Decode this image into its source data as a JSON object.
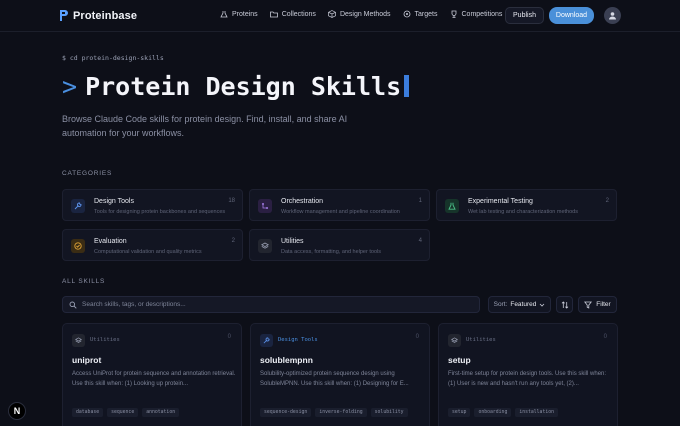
{
  "header": {
    "logo_text": "Proteinbase",
    "nav": [
      {
        "label": "Proteins",
        "icon": "flask-icon"
      },
      {
        "label": "Collections",
        "icon": "folder-icon"
      },
      {
        "label": "Design Methods",
        "icon": "cube-icon"
      },
      {
        "label": "Targets",
        "icon": "target-icon"
      },
      {
        "label": "Competitions",
        "icon": "trophy-icon"
      }
    ],
    "publish_label": "Publish",
    "download_label": "Download"
  },
  "hero": {
    "command": "$ cd protein-design-skills",
    "prompt": ">",
    "title": "Protein Design Skills",
    "description": "Browse Claude Code skills for protein design. Find, install, and share AI automation for your workflows."
  },
  "categories": {
    "label": "CATEGORIES",
    "items": [
      {
        "name": "Design Tools",
        "desc": "Tools for designing protein backbones and sequences",
        "count": "18",
        "color": "#4a7fd6",
        "icon": "wrench-icon"
      },
      {
        "name": "Orchestration",
        "desc": "Workflow management and pipeline coordination",
        "count": "1",
        "color": "#9b6ee0",
        "icon": "workflow-icon"
      },
      {
        "name": "Experimental Testing",
        "desc": "Wet lab testing and characterization methods",
        "count": "2",
        "color": "#3fb87a",
        "icon": "beaker-icon"
      },
      {
        "name": "Evaluation",
        "desc": "Computational validation and quality metrics",
        "count": "2",
        "color": "#d99a2e",
        "icon": "check-circle-icon"
      },
      {
        "name": "Utilities",
        "desc": "Data access, formatting, and helper tools",
        "count": "4",
        "color": "#8b90a4",
        "icon": "layers-icon"
      }
    ]
  },
  "skills": {
    "label": "ALL SKILLS",
    "search_placeholder": "Search skills, tags, or descriptions...",
    "sort_prefix": "Sort:",
    "sort_value": "Featured",
    "filter_label": "Filter",
    "cards": [
      {
        "category": "Utilities",
        "cat_color": "#6a7086",
        "icon": "layers-icon",
        "count": "0",
        "title": "uniprot",
        "desc": "Access UniProt for protein sequence and annotation retrieval. Use this skill when: (1) Looking up protein...",
        "tags": [
          "database",
          "sequence",
          "annotation"
        ]
      },
      {
        "category": "Design Tools",
        "cat_color": "#4a8fe0",
        "icon": "wrench-icon",
        "count": "0",
        "title": "solublempnn",
        "desc": "Solubility-optimized protein sequence design using SolubleMPNN. Use this skill when: (1) Designing for E...",
        "tags": [
          "sequence-design",
          "inverse-folding",
          "solubility"
        ]
      },
      {
        "category": "Utilities",
        "cat_color": "#6a7086",
        "icon": "layers-icon",
        "count": "0",
        "title": "setup",
        "desc": "First-time setup for protein design tools. Use this skill when: (1) User is new and hasn't run any tools yet, (2)...",
        "tags": [
          "setup",
          "onboarding",
          "installation"
        ]
      }
    ]
  },
  "badge": {
    "letter": "N"
  }
}
